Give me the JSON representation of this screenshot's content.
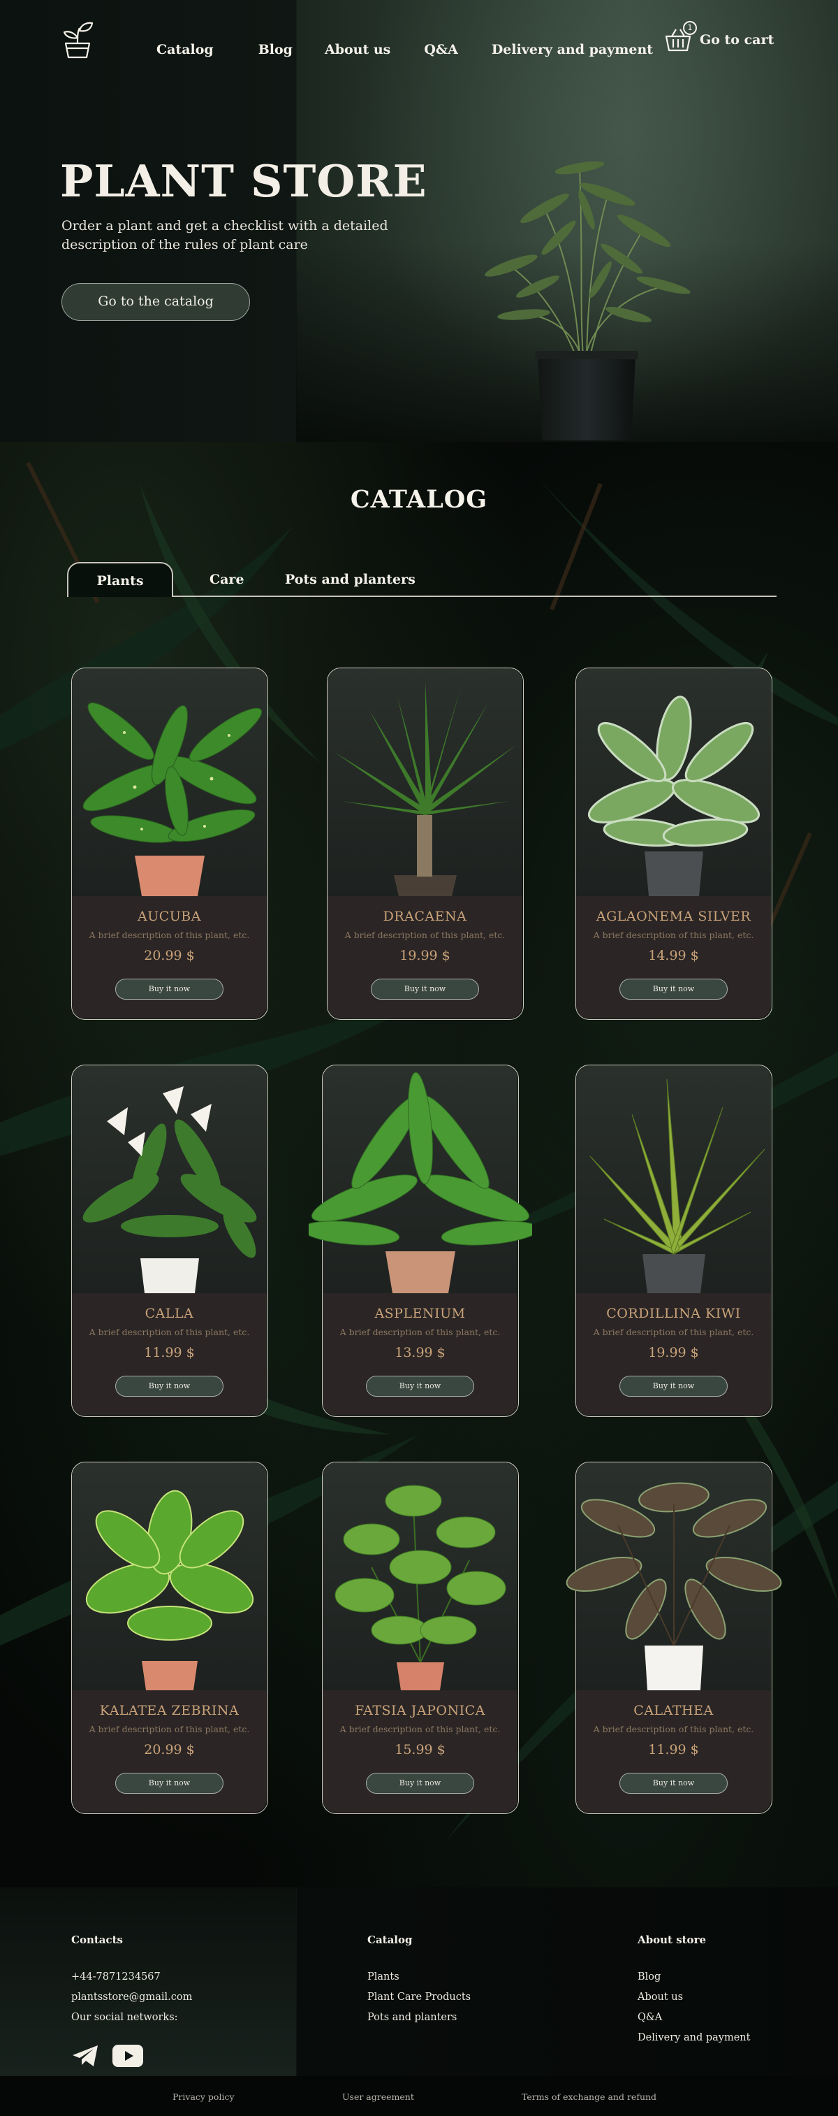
{
  "header": {
    "nav": [
      "Catalog",
      "Blog",
      "About us",
      "Q&A",
      "Delivery and payment"
    ],
    "cart_label": "Go to cart",
    "cart_count": "1"
  },
  "hero": {
    "title": "PLANT STORE",
    "subtitle": "Order a plant and get a checklist with a detailed description of the rules of plant care",
    "button": "Go to the catalog"
  },
  "catalog": {
    "title": "CATALOG",
    "tabs": [
      "Plants",
      "Care",
      "Pots and planters"
    ],
    "active_tab": "Plants",
    "buy_label": "Buy it now",
    "items": [
      {
        "name": "AUCUBA",
        "desc": "A brief description of this plant, etc.",
        "price": "20.99 $"
      },
      {
        "name": "DRACAENA",
        "desc": "A brief description of this plant, etc.",
        "price": "19.99 $"
      },
      {
        "name": "AGLAONEMA  SILVER",
        "desc": "A brief description of this plant, etc.",
        "price": "14.99 $"
      },
      {
        "name": "CALLA",
        "desc": "A brief description of this plant, etc.",
        "price": "11.99 $"
      },
      {
        "name": "ASPLENIUM",
        "desc": "A brief description of this plant, etc.",
        "price": "13.99 $"
      },
      {
        "name": "CORDILLINA KIWI",
        "desc": "A brief description of this plant, etc.",
        "price": "19.99 $"
      },
      {
        "name": "KALATEA ZEBRINA",
        "desc": "A brief description of this plant, etc.",
        "price": "20.99 $"
      },
      {
        "name": "FATSIA JAPONICA",
        "desc": "A brief description of this plant, etc.",
        "price": "15.99 $"
      },
      {
        "name": "CALATHEA",
        "desc": "A brief description of this plant, etc.",
        "price": "11.99 $"
      }
    ]
  },
  "footer": {
    "contacts": {
      "title": "Contacts",
      "phone": "+44-7871234567",
      "email": "plantsstore@gmail.com",
      "social_label": "Our social networks:",
      "social_icons": [
        "telegram-icon",
        "youtube-icon"
      ]
    },
    "catalog": {
      "title": "Catalog",
      "links": [
        "Plants",
        "Plant Care Products",
        "Pots and planters"
      ]
    },
    "about": {
      "title": "About store",
      "links": [
        "Blog",
        "About us",
        "Q&A",
        "Delivery and payment"
      ]
    },
    "legal": [
      "Privacy policy",
      "User agreement",
      "Terms of exchange and refund"
    ]
  },
  "colors": {
    "accent_text": "#c9a27a",
    "card_body": "#2b2625",
    "button_fill": "#3a4640",
    "background": "#050806"
  }
}
